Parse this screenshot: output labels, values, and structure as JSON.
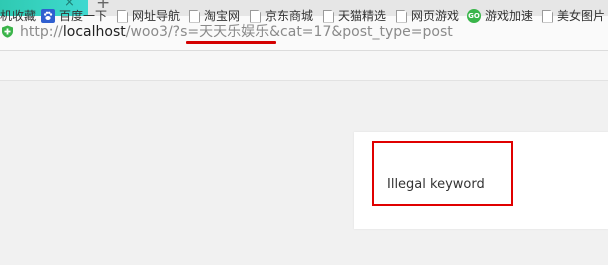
{
  "tab": {
    "close_glyph": "×",
    "new_tab_glyph": "+"
  },
  "address_bar": {
    "icon": "shield-icon",
    "scheme": "http://",
    "host": "localhost",
    "path": "/woo3/?s",
    "keyword_param": "=天天乐娱乐",
    "rest": "&cat=17&post_type=post"
  },
  "bookmarks": [
    {
      "label": "机收藏",
      "icon": "none"
    },
    {
      "label": "百度一下",
      "icon": "baidu-paw-icon"
    },
    {
      "label": "网址导航",
      "icon": "page-icon"
    },
    {
      "label": "淘宝网",
      "icon": "page-icon"
    },
    {
      "label": "京东商城",
      "icon": "page-icon"
    },
    {
      "label": "天猫精选",
      "icon": "page-icon"
    },
    {
      "label": "网页游戏",
      "icon": "page-icon"
    },
    {
      "label": "游戏加速",
      "icon": "game-icon"
    },
    {
      "label": "美女图片",
      "icon": "page-icon"
    }
  ],
  "game_icon_text": "GO",
  "content": {
    "message": "Illegal keyword"
  },
  "colors": {
    "annotation": "#e00000",
    "tab_accent": "#37d3c0"
  }
}
